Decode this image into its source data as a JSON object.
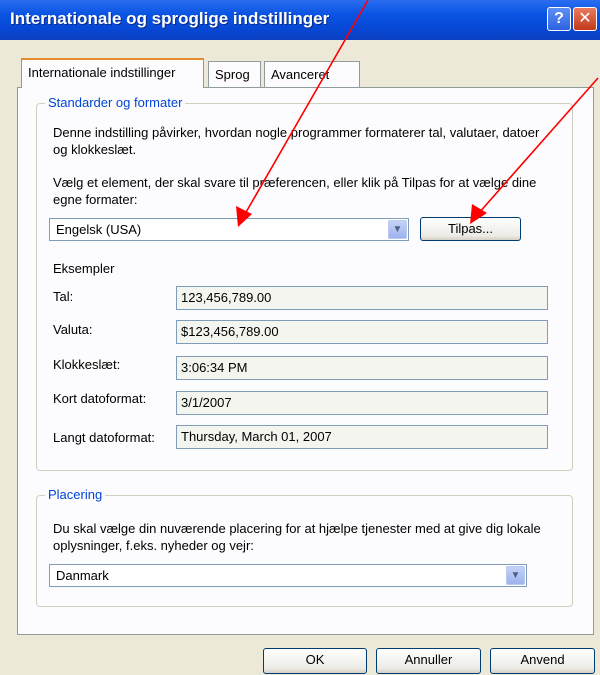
{
  "window": {
    "title": "Internationale og sproglige indstillinger",
    "help_glyph": "?",
    "close_glyph": "✕"
  },
  "tabs": [
    {
      "label": "Internationale indstillinger"
    },
    {
      "label": "Sprog"
    },
    {
      "label": "Avanceret"
    }
  ],
  "standards": {
    "legend": "Standarder og formater",
    "description": "Denne indstilling påvirker, hvordan nogle programmer formaterer tal, valutaer, datoer og klokkeslæt.",
    "instruction": "Vælg et element, der skal svare til præferencen, eller klik på Tilpas for at vælge dine egne formater:",
    "selected_locale": "Engelsk (USA)",
    "customize_button": "Tilpas...",
    "examples_heading": "Eksempler",
    "examples": [
      {
        "label": "Tal:",
        "value": "123,456,789.00"
      },
      {
        "label": "Valuta:",
        "value": "$123,456,789.00"
      },
      {
        "label": "Klokkeslæt:",
        "value": "3:06:34 PM"
      },
      {
        "label": "Kort datoformat:",
        "value": "3/1/2007"
      },
      {
        "label": "Langt datoformat:",
        "value": "Thursday, March 01, 2007"
      }
    ]
  },
  "location": {
    "legend": "Placering",
    "description": "Du skal vælge din nuværende placering for at hjælpe tjenester med at give dig lokale oplysninger, f.eks. nyheder og vejr:",
    "selected_location": "Danmark"
  },
  "buttons": {
    "ok": "OK",
    "cancel": "Annuller",
    "apply": "Anvend"
  },
  "colors": {
    "title_bar": "#0a54e3",
    "dialog_bg": "#ece9d8",
    "group_legend": "#0046d5",
    "annotation_arrow": "#ff0000",
    "active_tab_accent": "#e68b2c"
  }
}
